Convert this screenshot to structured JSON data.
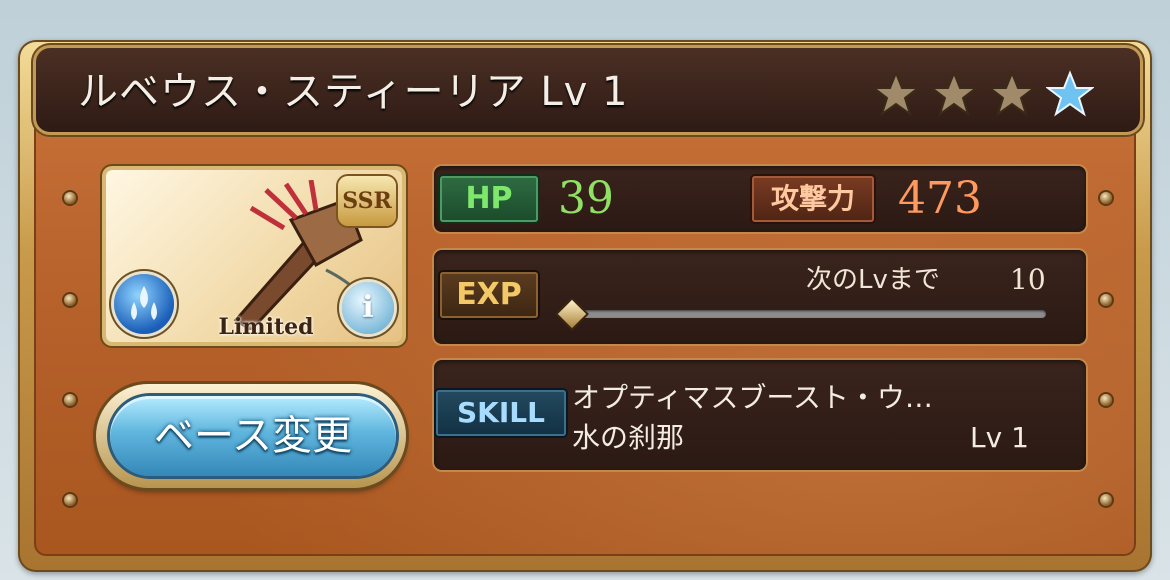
{
  "header": {
    "title": "ルベウス・スティーリア Lv 1",
    "stars_filled": 3,
    "stars_total": 4
  },
  "card": {
    "rarity": "SSR",
    "badge": "Limited",
    "element_icon": "water-icon",
    "info_label": "i"
  },
  "actions": {
    "change_base_label": "ベース変更"
  },
  "stats": {
    "hp_label": "HP",
    "hp_value": "39",
    "atk_label": "攻撃力",
    "atk_value": "473"
  },
  "exp": {
    "label": "EXP",
    "next_label": "次のLvまで",
    "next_value": "10",
    "progress": 0
  },
  "skill": {
    "label": "SKILL",
    "name": "オプティマスブースト・ウ…",
    "subname": "水の刹那",
    "level": "Lv 1"
  },
  "colors": {
    "hp": "#8fe063",
    "attack": "#ff9a5e",
    "panel": "#b8622c",
    "title_bar": "#2e1b15"
  }
}
